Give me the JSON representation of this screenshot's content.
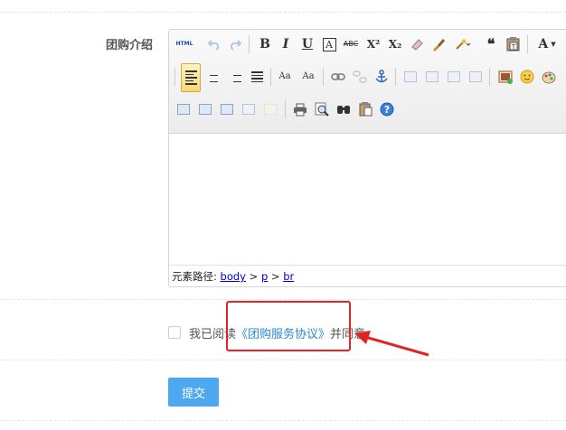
{
  "form": {
    "label": "团购介绍",
    "editor": {
      "toolbar": {
        "html_label": "HTML",
        "bold": "B",
        "italic": "I",
        "underline": "U",
        "font_color": "A",
        "strike": "ABC",
        "superscript": "X²",
        "subscript": "X₂",
        "quote": "❝",
        "font_size": "A",
        "rtl": "Aa",
        "ltr": "Aa"
      },
      "path": {
        "prefix": "元素路径:",
        "items": [
          "body",
          "p",
          "br"
        ],
        "separator": ">"
      }
    },
    "agreement": {
      "before": "我已阅读",
      "link": "《团购服务协议》",
      "after": "并同意"
    },
    "submit_label": "提交"
  },
  "colors": {
    "link": "#2a8ad4",
    "submit_bg": "#4ea8f0",
    "annotation": "#e02424"
  }
}
